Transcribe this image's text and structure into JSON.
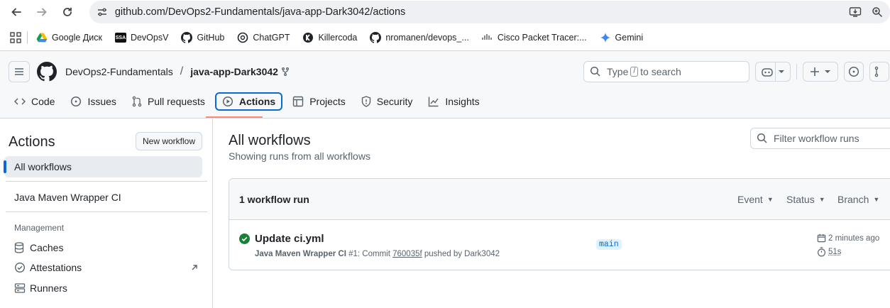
{
  "browser": {
    "url": "github.com/DevOps2-Fundamentals/java-app-Dark3042/actions",
    "bookmarks": [
      {
        "label": "Google Диск",
        "icon": "google-drive-icon"
      },
      {
        "label": "DevOpsV",
        "icon": "ssa-icon"
      },
      {
        "label": "GitHub",
        "icon": "github-icon"
      },
      {
        "label": "ChatGPT",
        "icon": "chatgpt-icon"
      },
      {
        "label": "Killercoda",
        "icon": "killercoda-icon"
      },
      {
        "label": "nromanen/devops_...",
        "icon": "github-icon"
      },
      {
        "label": "Cisco Packet Tracer:...",
        "icon": "cisco-icon"
      },
      {
        "label": "Gemini",
        "icon": "gemini-icon"
      }
    ],
    "bookmark_badge": "SSA"
  },
  "github": {
    "owner": "DevOps2-Fundamentals",
    "repo": "java-app-Dark3042",
    "search_prefix": "Type",
    "search_key": "/",
    "search_suffix": "to search",
    "tabs": [
      {
        "label": "Code",
        "icon": "code-icon"
      },
      {
        "label": "Issues",
        "icon": "issue-icon"
      },
      {
        "label": "Pull requests",
        "icon": "pull-request-icon"
      },
      {
        "label": "Actions",
        "icon": "play-icon",
        "selected": true
      },
      {
        "label": "Projects",
        "icon": "table-icon"
      },
      {
        "label": "Security",
        "icon": "shield-icon"
      },
      {
        "label": "Insights",
        "icon": "graph-icon"
      }
    ]
  },
  "sidebar": {
    "title": "Actions",
    "new_workflow": "New workflow",
    "all_workflows": "All workflows",
    "workflow": "Java Maven Wrapper CI",
    "management_label": "Management",
    "management": [
      {
        "label": "Caches",
        "icon": "cache-icon"
      },
      {
        "label": "Attestations",
        "icon": "check-circle-icon"
      },
      {
        "label": "Runners",
        "icon": "server-icon"
      }
    ]
  },
  "main": {
    "title": "All workflows",
    "subtitle": "Showing runs from all workflows",
    "filter_placeholder": "Filter workflow runs",
    "runs_count": "1 workflow run",
    "filters": [
      "Event",
      "Status",
      "Branch"
    ],
    "run": {
      "title": "Update ci.yml",
      "workflow": "Java Maven Wrapper CI",
      "run_number": "#1",
      "commit_text": ": Commit",
      "commit": "760035f",
      "pushed_by": "pushed by Dark3042",
      "branch": "main",
      "when": "2 minutes ago",
      "duration": "51s",
      "status": "success"
    }
  },
  "colors": {
    "accent": "#0969da",
    "success": "#1a7f37",
    "underline": "#fd8c73"
  }
}
